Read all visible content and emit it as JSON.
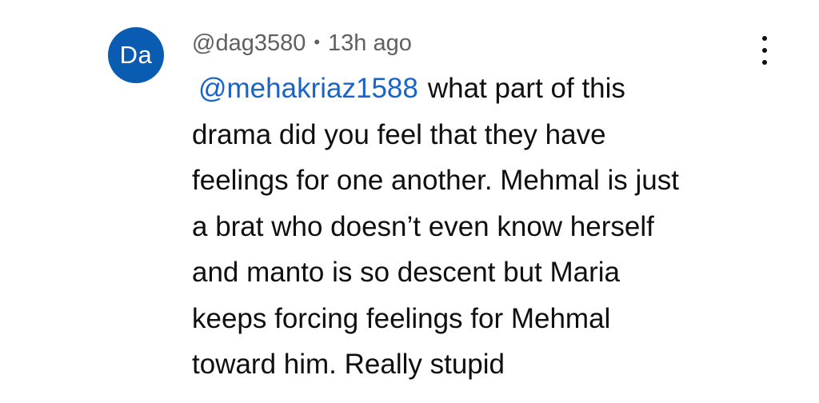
{
  "avatar": {
    "initials": "Da",
    "color": "#0a5cb3"
  },
  "comment": {
    "author": "@dag3580",
    "separator": "•",
    "timestamp": "13h ago",
    "mention": "@mehakriaz1588",
    "lines": [
      "what part of this",
      "drama did you feel that they have",
      "feelings for one another. Mehmal is just",
      "a brat who doesn’t even know herself",
      "and manto is so descent but Maria",
      "keeps forcing feelings for Mehmal",
      "toward him. Really stupid"
    ]
  },
  "menu": {
    "icon": "more-vert-icon"
  },
  "colors": {
    "mention": "#1a64c8",
    "meta_text": "#606060",
    "body_text": "#0f0f0f"
  }
}
